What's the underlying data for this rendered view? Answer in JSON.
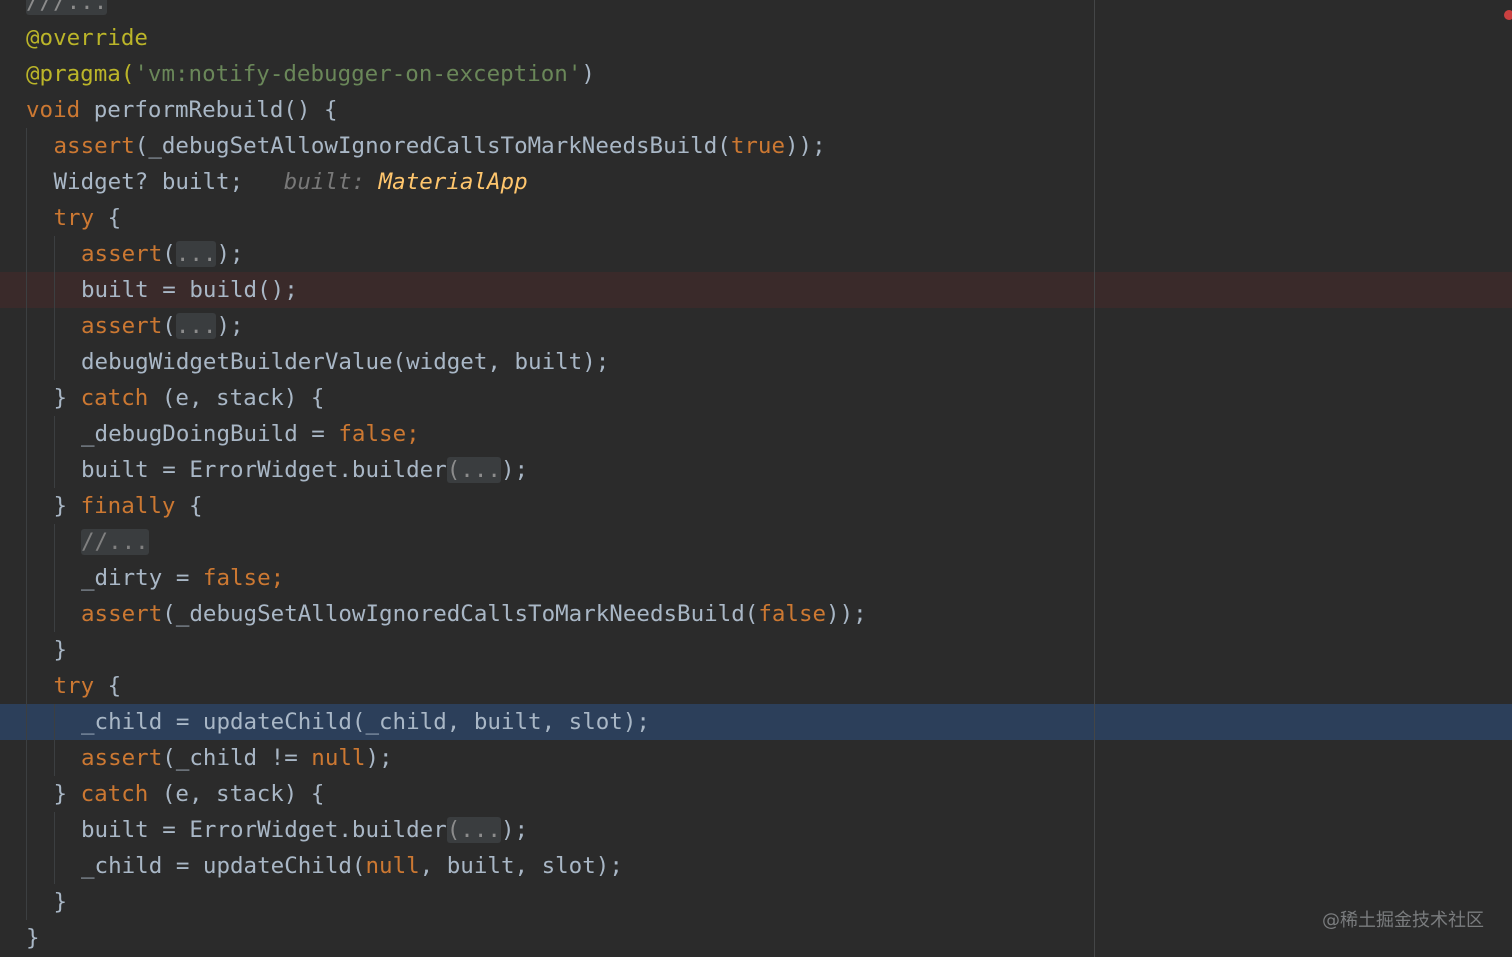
{
  "editor": {
    "folded_top": "///...",
    "annotation_override": "@override",
    "pragma_prefix": "@pragma(",
    "pragma_string": "'vm:notify-debugger-on-exception'",
    "pragma_suffix": ")",
    "sig_keyword": "void",
    "sig_rest": " performRebuild() {",
    "assert_kw": "assert",
    "allow_call": "(_debugSetAllowIgnoredCallsToMarkNeedsBuild(",
    "true_kw": "true",
    "close_paren_semi": "));",
    "widget_decl": "Widget? built;",
    "hint_label": "built:",
    "hint_value": "MaterialApp",
    "try_kw": "try",
    "open_brace": " {",
    "paren_open": "(",
    "fold_ellipsis": "...",
    "paren_close_semi": ");",
    "built_eq_build": "built = build();",
    "debug_value": "debugWidgetBuilderValue(widget, built);",
    "brace_close": "}",
    "catch_kw": "catch",
    "catch_args": " (e, stack) {",
    "debug_doing": "_debugDoingBuild = ",
    "false_kw": "false",
    "semi": ";",
    "built_error": "built = ErrorWidget.builder",
    "finally_kw": "finally",
    "comment_fold": "//...",
    "dirty_assign": "_dirty = ",
    "false_close": "));",
    "child_update": "_child = updateChild(_child, built, slot);",
    "assert_child": "(_child != ",
    "null_kw": "null",
    "child_update_null_prefix": "_child = updateChild(",
    "child_update_null_suffix": ", built, slot);",
    "semi_paren": ");"
  },
  "watermark": "@稀土掘金技术社区",
  "colors": {
    "background": "#2b2b2b",
    "keyword": "#cc7832",
    "string": "#6a8759",
    "annotation": "#bbb529",
    "text": "#a9b7c6",
    "hint_value": "#ffc66d",
    "breakpoint_line": "#3a2a2a",
    "caret_line": "#2c3f5a"
  }
}
